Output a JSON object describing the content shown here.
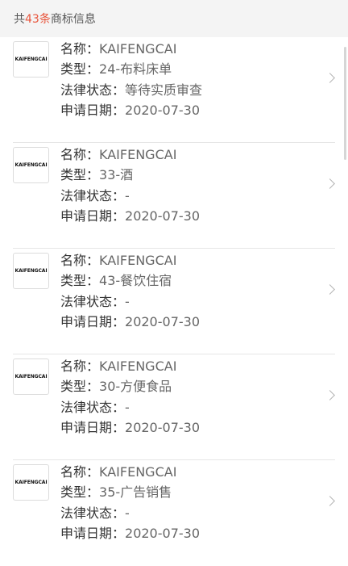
{
  "summary": {
    "prefix": "共",
    "count": "43条",
    "suffix": "商标信息"
  },
  "labels": {
    "name": "名称：",
    "type": "类型：",
    "status": "法律状态：",
    "date": "申请日期："
  },
  "trademarks": [
    {
      "logo_text": "KAIFENGCAI",
      "name": "KAIFENGCAI",
      "type": "24-布料床单",
      "status": "等待实质审查",
      "date": "2020-07-30"
    },
    {
      "logo_text": "KAIFENGCAI",
      "name": "KAIFENGCAI",
      "type": "33-酒",
      "status": "-",
      "date": "2020-07-30"
    },
    {
      "logo_text": "KAIFENGCAI",
      "name": "KAIFENGCAI",
      "type": "43-餐饮住宿",
      "status": "-",
      "date": "2020-07-30"
    },
    {
      "logo_text": "KAIFENGCAI",
      "name": "KAIFENGCAI",
      "type": "30-方便食品",
      "status": "-",
      "date": "2020-07-30"
    },
    {
      "logo_text": "KAIFENGCAI",
      "name": "KAIFENGCAI",
      "type": "35-广告销售",
      "status": "-",
      "date": "2020-07-30"
    }
  ],
  "icons": {
    "row_arrow": "chevron-right-icon"
  }
}
